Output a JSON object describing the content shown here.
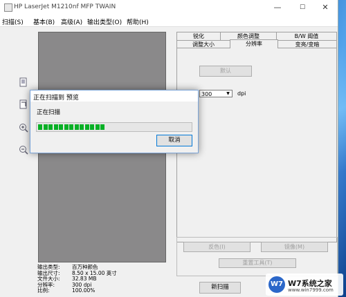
{
  "window": {
    "title": "HP LaserJet M1210nf MFP TWAIN",
    "minimize": "—",
    "maximize": "☐",
    "close": "✕"
  },
  "menu": [
    "扫描(S)",
    "基本(B)",
    "高级(A)",
    "输出类型(O)",
    "帮助(H)"
  ],
  "tabs_row1": [
    "锐化",
    "颜色调整",
    "B/W 阈值"
  ],
  "tabs_row2": [
    "调整大小",
    "分辨率",
    "变亮/变暗"
  ],
  "active_tab": "分辨率",
  "resolution_panel": {
    "default_button": "默认",
    "dpi_value": "300",
    "dpi_unit": "dpi"
  },
  "lower_buttons": {
    "invert": "反色(I)",
    "mirror": "镜像(M)",
    "reset_tools": "重置工具(T)"
  },
  "scan_info": [
    {
      "label": "输出类型:",
      "value": "百万种颜色"
    },
    {
      "label": "输出尺寸:",
      "value": "8.50 x 15.00 英寸"
    },
    {
      "label": "文件大小:",
      "value": "32.83 MB"
    },
    {
      "label": "分辨率:",
      "value": "300 dpi"
    },
    {
      "label": "比例:",
      "value": "100.00%"
    }
  ],
  "new_scan_button": "新扫描",
  "dialog": {
    "title": "正在扫描到 预览",
    "message": "正在扫描",
    "cancel": "取消",
    "progress_fraction": 0.47
  },
  "watermark": {
    "logo": "W7",
    "text": "W7系统之家",
    "url": "www.win7999.com"
  },
  "colors": {
    "progress_green": "#06b025",
    "preview_gray": "#8a898a"
  }
}
